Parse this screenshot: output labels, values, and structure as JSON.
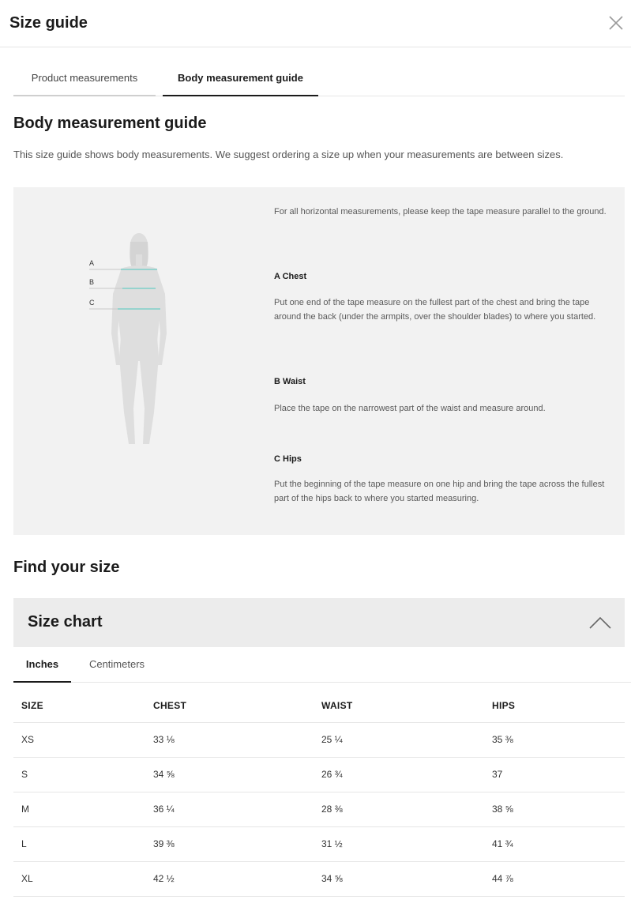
{
  "header": {
    "title": "Size guide"
  },
  "tabs": [
    {
      "label": "Product measurements",
      "active": false
    },
    {
      "label": "Body measurement guide",
      "active": true
    }
  ],
  "section": {
    "title": "Body measurement guide",
    "intro": "This size guide shows body measurements. We suggest ordering a size up when your measurements are between sizes."
  },
  "guide": {
    "figure_labels": [
      "A",
      "B",
      "C"
    ],
    "general_note": "For all horizontal measurements, please keep the tape measure parallel to the ground.",
    "chest": {
      "heading": "A Chest",
      "text": "Put one end of the tape measure on the fullest part of the chest and bring the tape around the back (under the armpits, over the shoulder blades) to where you started."
    },
    "waist": {
      "heading": "B Waist",
      "text": "Place the tape on the narrowest part of the waist and measure around."
    },
    "hips": {
      "heading": "C Hips",
      "text": "Put the beginning of the tape measure on one hip and bring the tape across the fullest part of the hips back to where you started measuring."
    }
  },
  "find": {
    "title": "Find your size",
    "chart_title": "Size chart",
    "units": [
      {
        "label": "Inches",
        "active": true
      },
      {
        "label": "Centimeters",
        "active": false
      }
    ]
  },
  "table": {
    "headers": [
      "SIZE",
      "CHEST",
      "WAIST",
      "HIPS"
    ],
    "rows": [
      [
        "XS",
        "33 ⅛",
        "25 ¼",
        "35 ⅜"
      ],
      [
        "S",
        "34 ⅝",
        "26 ¾",
        "37"
      ],
      [
        "M",
        "36 ¼",
        "28 ⅜",
        "38 ⅝"
      ],
      [
        "L",
        "39 ⅜",
        "31 ½",
        "41 ¾"
      ],
      [
        "XL",
        "42 ½",
        "34 ⅝",
        "44 ⅞"
      ]
    ]
  },
  "colors": {
    "accent_line": "#7fcfc8",
    "panel_bg": "#f2f2f2",
    "figure": "#dedede"
  },
  "icons": {
    "close": "close-icon",
    "collapse": "chevron-up-icon"
  }
}
